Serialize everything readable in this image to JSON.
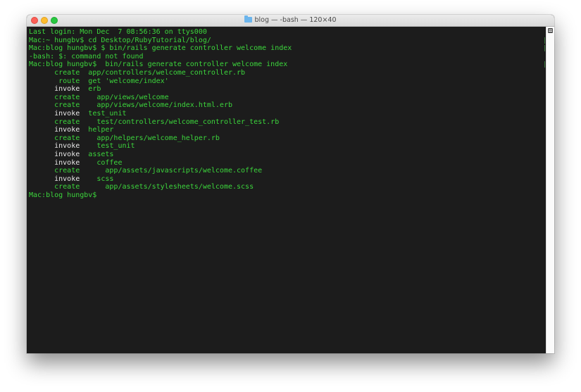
{
  "window": {
    "title": "blog — -bash — 120×40",
    "title_icon": "folder-icon"
  },
  "terminal": {
    "lines": [
      {
        "segments": [
          {
            "text": "Last login: Mon Dec  7 08:56:36 on ttys000",
            "color": "green"
          }
        ]
      },
      {
        "segments": [
          {
            "text": "Mac:~ hungbv$ cd Desktop/RubyTutorial/blog/",
            "color": "green"
          }
        ],
        "marked": true
      },
      {
        "segments": [
          {
            "text": "Mac:blog hungbv$ $ bin/rails generate controller welcome index",
            "color": "green"
          }
        ],
        "marked": true
      },
      {
        "segments": [
          {
            "text": "-bash: $: command not found",
            "color": "green"
          }
        ]
      },
      {
        "segments": [
          {
            "text": "Mac:blog hungbv$  bin/rails generate controller welcome index",
            "color": "green"
          }
        ],
        "marked": true
      },
      {
        "segments": [
          {
            "text": "      create  ",
            "color": "green"
          },
          {
            "text": "app/controllers/welcome_controller.rb",
            "color": "green"
          }
        ]
      },
      {
        "segments": [
          {
            "text": "       route  ",
            "color": "green"
          },
          {
            "text": "get 'welcome/index'",
            "color": "green"
          }
        ]
      },
      {
        "segments": [
          {
            "text": "      invoke  ",
            "color": "white"
          },
          {
            "text": "erb",
            "color": "green"
          }
        ]
      },
      {
        "segments": [
          {
            "text": "      create  ",
            "color": "green"
          },
          {
            "text": "  app/views/welcome",
            "color": "green"
          }
        ]
      },
      {
        "segments": [
          {
            "text": "      create  ",
            "color": "green"
          },
          {
            "text": "  app/views/welcome/index.html.erb",
            "color": "green"
          }
        ]
      },
      {
        "segments": [
          {
            "text": "      invoke  ",
            "color": "white"
          },
          {
            "text": "test_unit",
            "color": "green"
          }
        ]
      },
      {
        "segments": [
          {
            "text": "      create  ",
            "color": "green"
          },
          {
            "text": "  test/controllers/welcome_controller_test.rb",
            "color": "green"
          }
        ]
      },
      {
        "segments": [
          {
            "text": "      invoke  ",
            "color": "white"
          },
          {
            "text": "helper",
            "color": "green"
          }
        ]
      },
      {
        "segments": [
          {
            "text": "      create  ",
            "color": "green"
          },
          {
            "text": "  app/helpers/welcome_helper.rb",
            "color": "green"
          }
        ]
      },
      {
        "segments": [
          {
            "text": "      invoke  ",
            "color": "white"
          },
          {
            "text": "  test_unit",
            "color": "green"
          }
        ]
      },
      {
        "segments": [
          {
            "text": "      invoke  ",
            "color": "white"
          },
          {
            "text": "assets",
            "color": "green"
          }
        ]
      },
      {
        "segments": [
          {
            "text": "      invoke  ",
            "color": "white"
          },
          {
            "text": "  coffee",
            "color": "green"
          }
        ]
      },
      {
        "segments": [
          {
            "text": "      create  ",
            "color": "green"
          },
          {
            "text": "    app/assets/javascripts/welcome.coffee",
            "color": "green"
          }
        ]
      },
      {
        "segments": [
          {
            "text": "      invoke  ",
            "color": "white"
          },
          {
            "text": "  scss",
            "color": "green"
          }
        ]
      },
      {
        "segments": [
          {
            "text": "      create  ",
            "color": "green"
          },
          {
            "text": "    app/assets/stylesheets/welcome.scss",
            "color": "green"
          }
        ]
      },
      {
        "segments": [
          {
            "text": "Mac:blog hungbv$ ",
            "color": "green"
          }
        ]
      }
    ]
  },
  "colors": {
    "background": "#1c1c1c",
    "green": "#3cd53c",
    "white": "#e8e8e8"
  }
}
